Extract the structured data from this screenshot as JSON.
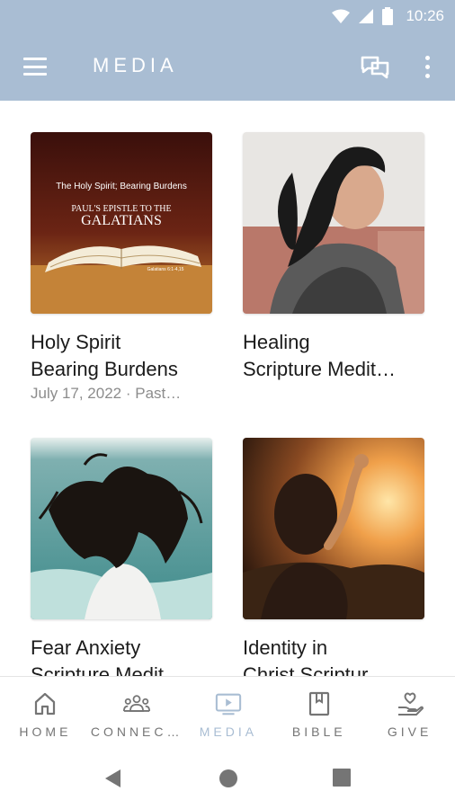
{
  "status_bar": {
    "time": "10:26"
  },
  "app_bar": {
    "title": "MEDIA",
    "menu_icon": "menu-icon",
    "chat_icon": "chat-icon",
    "more_icon": "more-vert-icon",
    "background": "#a9bdd3"
  },
  "media_items": [
    {
      "title_line1": "Holy Spirit",
      "title_line2": "Bearing Burdens",
      "subtitle": "July 17, 2022 · Past…",
      "thumb_text_1": "The Holy Spirit; Bearing Burdens",
      "thumb_text_2": "PAUL'S EPISTLE TO THE",
      "thumb_text_3": "GALATIANS",
      "thumb_text_4": "Galatians 6:1-4,15"
    },
    {
      "title_line1": "Healing",
      "title_line2": "Scripture Medit…",
      "subtitle": ""
    },
    {
      "title_line1": "Fear Anxiety",
      "title_line2": "Scripture Medit…",
      "subtitle": ""
    },
    {
      "title_line1": "Identity in",
      "title_line2": "Christ Scriptur…",
      "subtitle": ""
    }
  ],
  "bottom_nav": {
    "items": [
      {
        "label": "HOME",
        "icon": "home-icon"
      },
      {
        "label": "CONNEC…",
        "icon": "people-icon"
      },
      {
        "label": "MEDIA",
        "icon": "tv-icon",
        "active": true
      },
      {
        "label": "BIBLE",
        "icon": "book-icon"
      },
      {
        "label": "GIVE",
        "icon": "heart-hand-icon"
      }
    ],
    "active_color": "#a9bdd3",
    "inactive_color": "#757575"
  }
}
